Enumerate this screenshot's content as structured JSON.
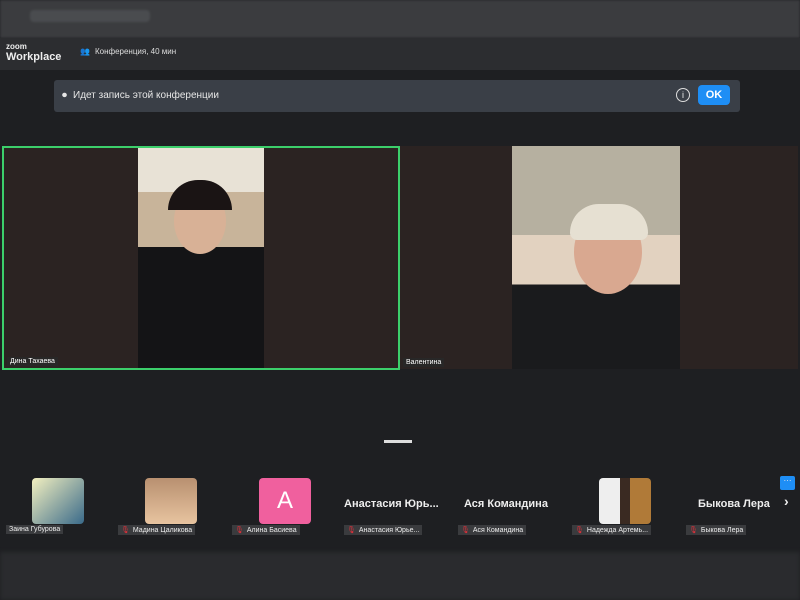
{
  "header": {
    "logo_small": "zoom",
    "logo_big": "Workplace",
    "meeting": "Конференция, 40 мин"
  },
  "banner": {
    "text": "Идет запись этой конференции",
    "ok": "OK"
  },
  "videos": [
    {
      "name": "Дина Тахаева",
      "active": true
    },
    {
      "name": "Валентина",
      "active": false
    }
  ],
  "participants": [
    {
      "label": "Заина Губурова",
      "avatar": "photo",
      "muted": false
    },
    {
      "label": "Мадина Цаликова",
      "avatar": "photo",
      "muted": true
    },
    {
      "label": "Алина Басиева",
      "avatar": "A",
      "avatar_color": "#f0609e",
      "muted": true
    },
    {
      "label": "Анастасия Юрье...",
      "display": "Анастасия  Юрь...",
      "muted": true
    },
    {
      "label": "Ася Командина",
      "display": "Ася Командина",
      "muted": true
    },
    {
      "label": "Надежда Артемь...",
      "avatar": "photo",
      "muted": true
    },
    {
      "label": "Быкова Лера",
      "display": "Быкова Лера",
      "muted": true
    }
  ],
  "controls": {
    "more": "···",
    "next": "›"
  },
  "colors": {
    "active_border": "#3ccf6b",
    "accent": "#1e8ef5"
  }
}
